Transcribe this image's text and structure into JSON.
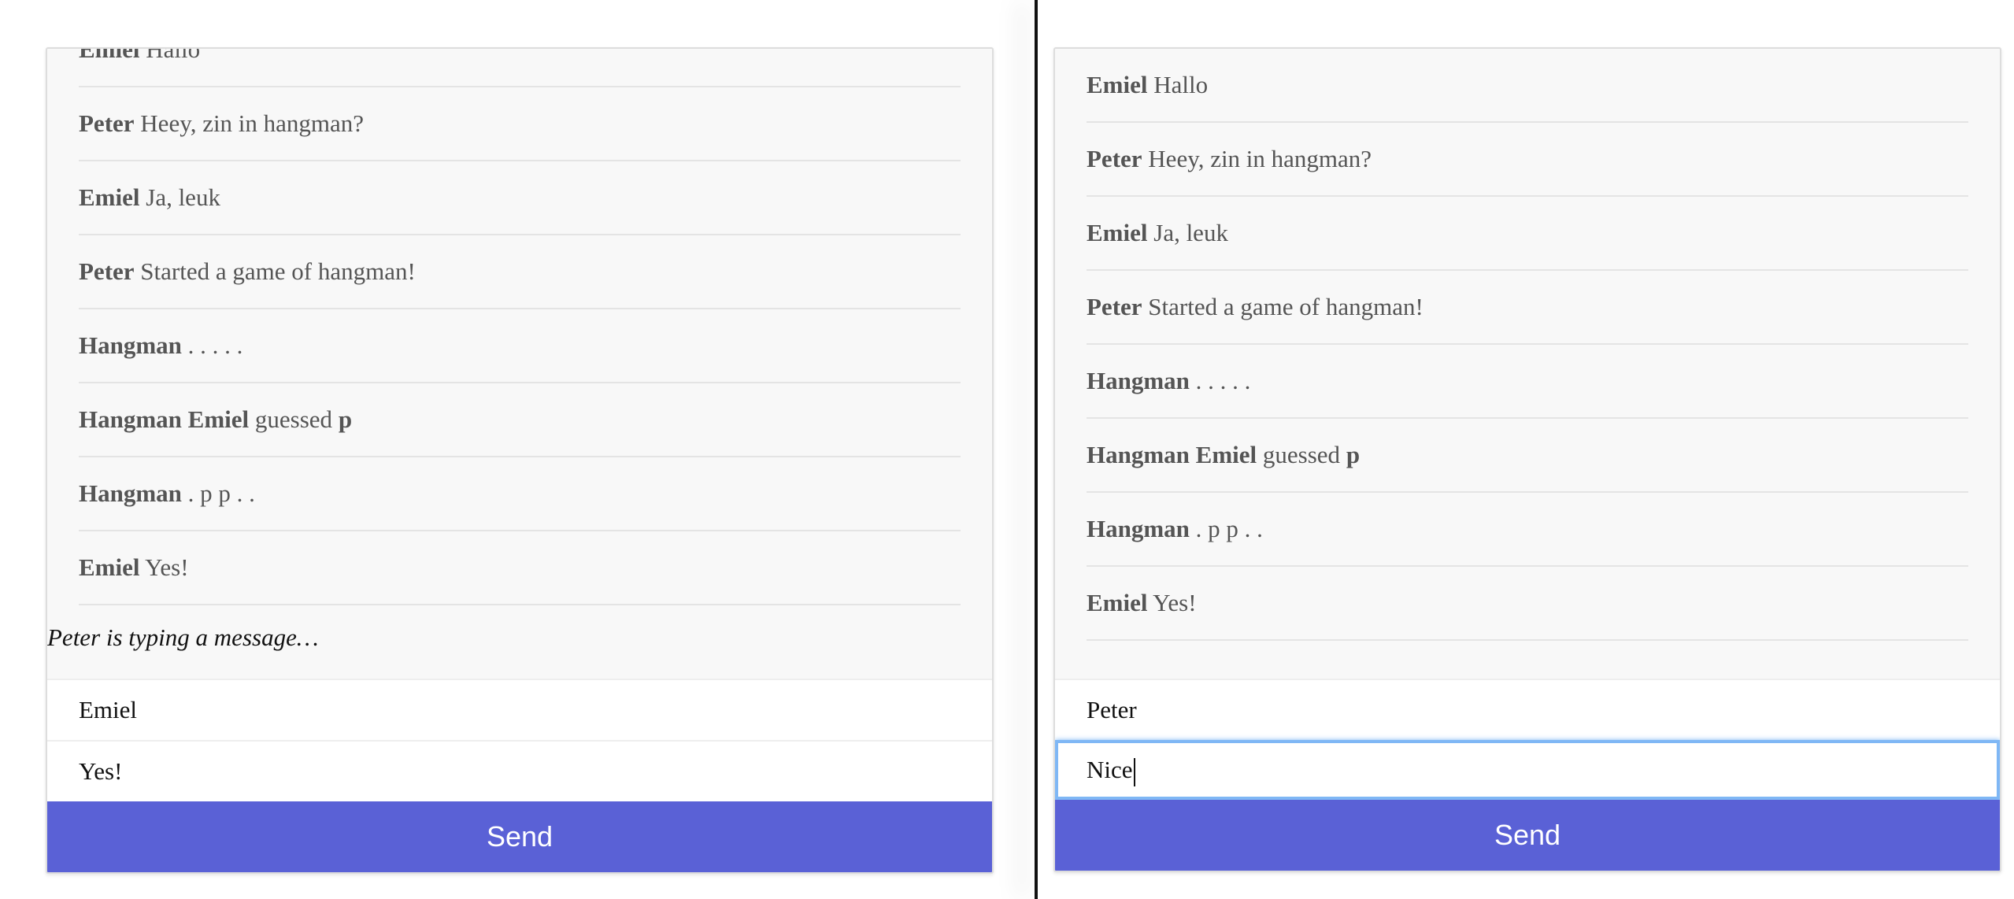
{
  "left": {
    "messages": [
      {
        "author": "Emiel",
        "text": "Hallo",
        "bold_tail": ""
      },
      {
        "author": "Peter",
        "text": "Heey, zin in hangman?",
        "bold_tail": ""
      },
      {
        "author": "Emiel",
        "text": "Ja, leuk",
        "bold_tail": ""
      },
      {
        "author": "Peter",
        "text": "Started a game of hangman!",
        "bold_tail": ""
      },
      {
        "author": "Hangman",
        "text": ". . . . .",
        "bold_tail": ""
      },
      {
        "author": "Hangman Emiel",
        "text": "guessed",
        "bold_tail": "p"
      },
      {
        "author": "Hangman",
        "text": ". p p . .",
        "bold_tail": ""
      },
      {
        "author": "Emiel",
        "text": "Yes!",
        "bold_tail": ""
      }
    ],
    "typing_indicator": "Peter is typing a message…",
    "name_value": "Emiel",
    "message_value": "Yes!",
    "send_label": "Send"
  },
  "right": {
    "messages": [
      {
        "author": "Emiel",
        "text": "Hallo",
        "bold_tail": ""
      },
      {
        "author": "Peter",
        "text": "Heey, zin in hangman?",
        "bold_tail": ""
      },
      {
        "author": "Emiel",
        "text": "Ja, leuk",
        "bold_tail": ""
      },
      {
        "author": "Peter",
        "text": "Started a game of hangman!",
        "bold_tail": ""
      },
      {
        "author": "Hangman",
        "text": ". . . . .",
        "bold_tail": ""
      },
      {
        "author": "Hangman Emiel",
        "text": "guessed",
        "bold_tail": "p"
      },
      {
        "author": "Hangman",
        "text": ". p p . .",
        "bold_tail": ""
      },
      {
        "author": "Emiel",
        "text": "Yes!",
        "bold_tail": ""
      }
    ],
    "name_value": "Peter",
    "message_value": "Nice",
    "send_label": "Send"
  },
  "colors": {
    "send_button": "#5a61d6",
    "focus_ring": "#7fb7f5",
    "panel_bg": "#f8f8f8"
  }
}
